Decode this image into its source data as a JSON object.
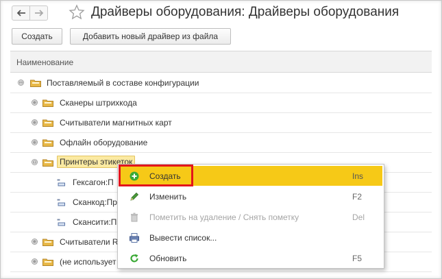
{
  "header": {
    "title": "Драйверы оборудования: Драйверы оборудования",
    "back_icon": "arrow-left-icon",
    "forward_icon": "arrow-right-icon",
    "favorite_icon": "star-icon"
  },
  "toolbar": {
    "create_label": "Создать",
    "add_driver_label": "Добавить новый драйвер из файла"
  },
  "table": {
    "column_header": "Наименование",
    "rows": [
      {
        "label": "Поставляемый в составе конфигурации",
        "expander": "⊖",
        "type": "group-open"
      },
      {
        "label": "Сканеры штрихкода",
        "expander": "⊕",
        "type": "group"
      },
      {
        "label": "Считыватели магнитных карт",
        "expander": "⊕",
        "type": "group"
      },
      {
        "label": "Офлайн оборудование",
        "expander": "⊕",
        "type": "group"
      },
      {
        "label": "Принтеры этикеток",
        "expander": "⊖",
        "type": "group-open-selected"
      },
      {
        "label": "Гексагон:П",
        "type": "item"
      },
      {
        "label": "Сканкод:Пр",
        "type": "item"
      },
      {
        "label": "Скансити:П",
        "type": "item"
      },
      {
        "label": "Считыватели R",
        "expander": "⊕",
        "type": "group"
      },
      {
        "label": "(не использует",
        "expander": "⊕",
        "type": "group"
      }
    ]
  },
  "context_menu": {
    "items": [
      {
        "label": "Создать",
        "shortcut": "Ins",
        "icon": "plus-circle-icon",
        "state": "highlighted"
      },
      {
        "label": "Изменить",
        "shortcut": "F2",
        "icon": "pencil-icon",
        "state": "enabled"
      },
      {
        "label": "Пометить на удаление / Снять пометку",
        "shortcut": "Del",
        "icon": "trash-icon",
        "state": "disabled"
      },
      {
        "label": "Вывести список...",
        "shortcut": "",
        "icon": "print-list-icon",
        "state": "enabled"
      },
      {
        "label": "Обновить",
        "shortcut": "F5",
        "icon": "refresh-icon",
        "state": "enabled"
      }
    ]
  },
  "colors": {
    "menu_highlight": "#f6c917",
    "selection_fill": "#fbeaa2",
    "callout_border": "#e3151b",
    "folder_fill": "#e8b847"
  }
}
